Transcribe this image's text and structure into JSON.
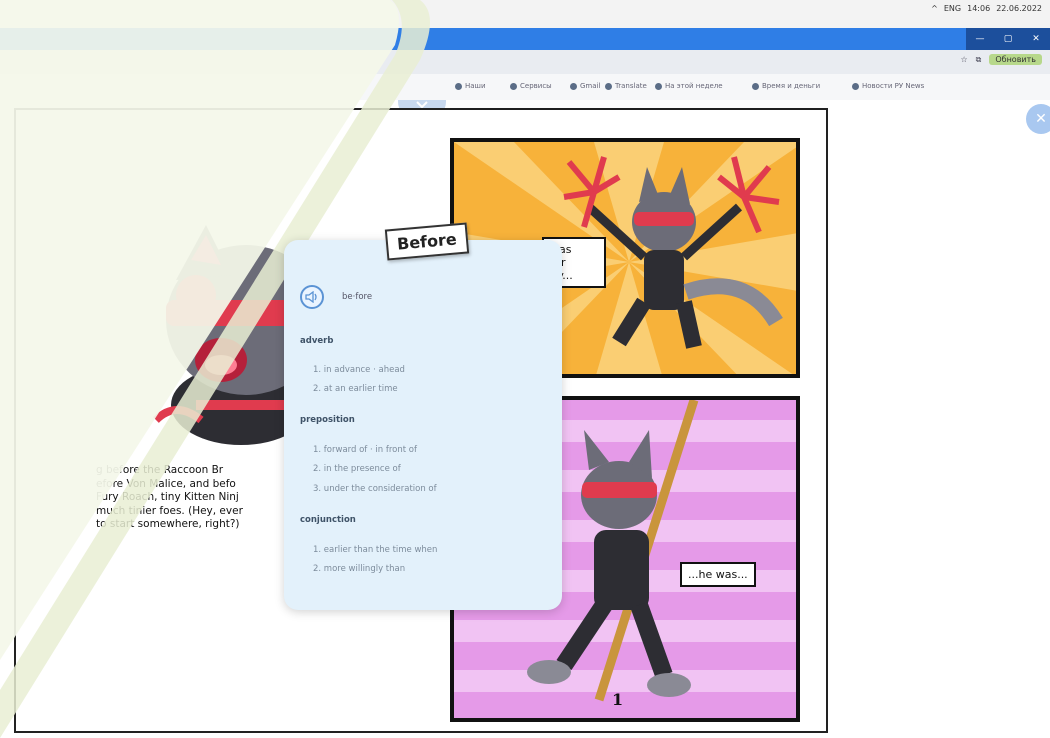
{
  "browser": {
    "tray_text": [
      "^",
      "ENG",
      "14:06",
      "22.06.2022"
    ],
    "profile_label": "Обновить",
    "bookmarks": [
      "Наши",
      "Сервисы",
      "Gmail",
      "Translate",
      "На этой неделе",
      "Время и деньги",
      "Новости РУ News"
    ]
  },
  "book": {
    "story_text": "g before the Raccoon Br… efore Von Malice, and befo… Fury Roach, tiny Kitten Ninj… much tinier foes. (Hey, ever… to start somewhere, right?)",
    "story_lines": [
      "g before the Raccoon Br",
      "efore Von Malice, and befo",
      "Fury Roach, tiny Kitten Ninj",
      "much tinier foes. (Hey, ever",
      "to start somewhere, right?)"
    ],
    "caption_top_lines": [
      "was",
      "tor",
      "ity..."
    ],
    "caption_bottom": "...he was...",
    "page_number": "1"
  },
  "popup": {
    "tag": "Before",
    "headword": "be·fore",
    "sections": [
      {
        "pos": "adverb",
        "defs": [
          "1. in advance · ahead",
          "2. at an earlier time"
        ]
      },
      {
        "pos": "preposition",
        "defs": [
          "1. forward of · in front of",
          "2. in the presence of",
          "3. under the consideration of"
        ]
      },
      {
        "pos": "conjunction",
        "defs": [
          "1. earlier than the time when",
          "2. more willingly than"
        ]
      }
    ]
  },
  "colors": {
    "panel_top": "#f7b23a",
    "panel_bottom": "#e59ae8",
    "popup_bg": "#e3f1fb",
    "accent_blue": "#2f7ee6",
    "wedge_fill": "#f4f7ea",
    "wedge_stroke": "#e9eed4"
  },
  "icons": [
    "speaker-icon",
    "close-icon",
    "chevron-down-icon"
  ]
}
